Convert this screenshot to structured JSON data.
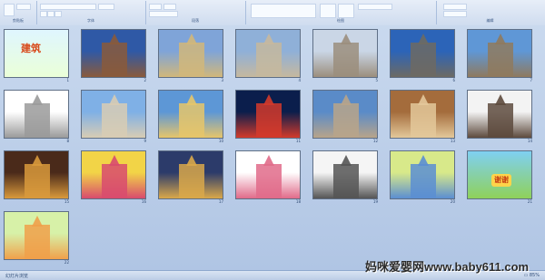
{
  "ribbon": {
    "groups": [
      "剪贴板",
      "字体",
      "段落",
      "绘图",
      "编辑"
    ]
  },
  "slides": [
    {
      "n": "1",
      "kind": "title",
      "title": "建筑"
    },
    {
      "n": "2",
      "kind": "photo",
      "c1": "#2f59a6",
      "c2": "#8a5a3b"
    },
    {
      "n": "3",
      "kind": "photo",
      "c1": "#7fa4d8",
      "c2": "#d1b77a"
    },
    {
      "n": "4",
      "kind": "photo",
      "c1": "#8fb0d8",
      "c2": "#c6b89e"
    },
    {
      "n": "5",
      "kind": "photo",
      "c1": "#cad6e6",
      "c2": "#9b8e7d"
    },
    {
      "n": "6",
      "kind": "photo",
      "c1": "#2c64b8",
      "c2": "#6d6a63"
    },
    {
      "n": "7",
      "kind": "photo",
      "c1": "#5f97d6",
      "c2": "#8f7a5e"
    },
    {
      "n": "8",
      "kind": "photo",
      "c1": "#ffffff",
      "c2": "#9a9a9a"
    },
    {
      "n": "9",
      "kind": "photo",
      "c1": "#7fb0e6",
      "c2": "#d8ccb4"
    },
    {
      "n": "10",
      "kind": "photo",
      "c1": "#5d97d6",
      "c2": "#e6c56a"
    },
    {
      "n": "11",
      "kind": "photo",
      "c1": "#0b1e4c",
      "c2": "#d33a2b"
    },
    {
      "n": "12",
      "kind": "photo",
      "c1": "#5a8bc8",
      "c2": "#b8a48a"
    },
    {
      "n": "13",
      "kind": "photo",
      "c1": "#a46c3c",
      "c2": "#e3c89a"
    },
    {
      "n": "14",
      "kind": "photo",
      "c1": "#f3f3f3",
      "c2": "#5d4a3d"
    },
    {
      "n": "15",
      "kind": "photo",
      "c1": "#4a2a1a",
      "c2": "#d99a3c"
    },
    {
      "n": "16",
      "kind": "photo",
      "c1": "#f2d447",
      "c2": "#d84b6e"
    },
    {
      "n": "17",
      "kind": "photo",
      "c1": "#2c3b6a",
      "c2": "#d9a84a"
    },
    {
      "n": "18",
      "kind": "photo",
      "c1": "#ffffff",
      "c2": "#e06b8a"
    },
    {
      "n": "19",
      "kind": "photo",
      "c1": "#f5f5f5",
      "c2": "#555555"
    },
    {
      "n": "20",
      "kind": "photo",
      "c1": "#d8e98a",
      "c2": "#5b8ed2"
    },
    {
      "n": "21",
      "kind": "thanks",
      "text": "谢谢",
      "c1": "#7fd0f2",
      "c2": "#8fd15a"
    },
    {
      "n": "22",
      "kind": "photo",
      "c1": "#d7f1a8",
      "c2": "#f0a04a"
    }
  ],
  "status": {
    "left": "幻灯片浏览",
    "right": "▭ 85%"
  },
  "watermark": "妈咪爱婴网www.baby611.com"
}
